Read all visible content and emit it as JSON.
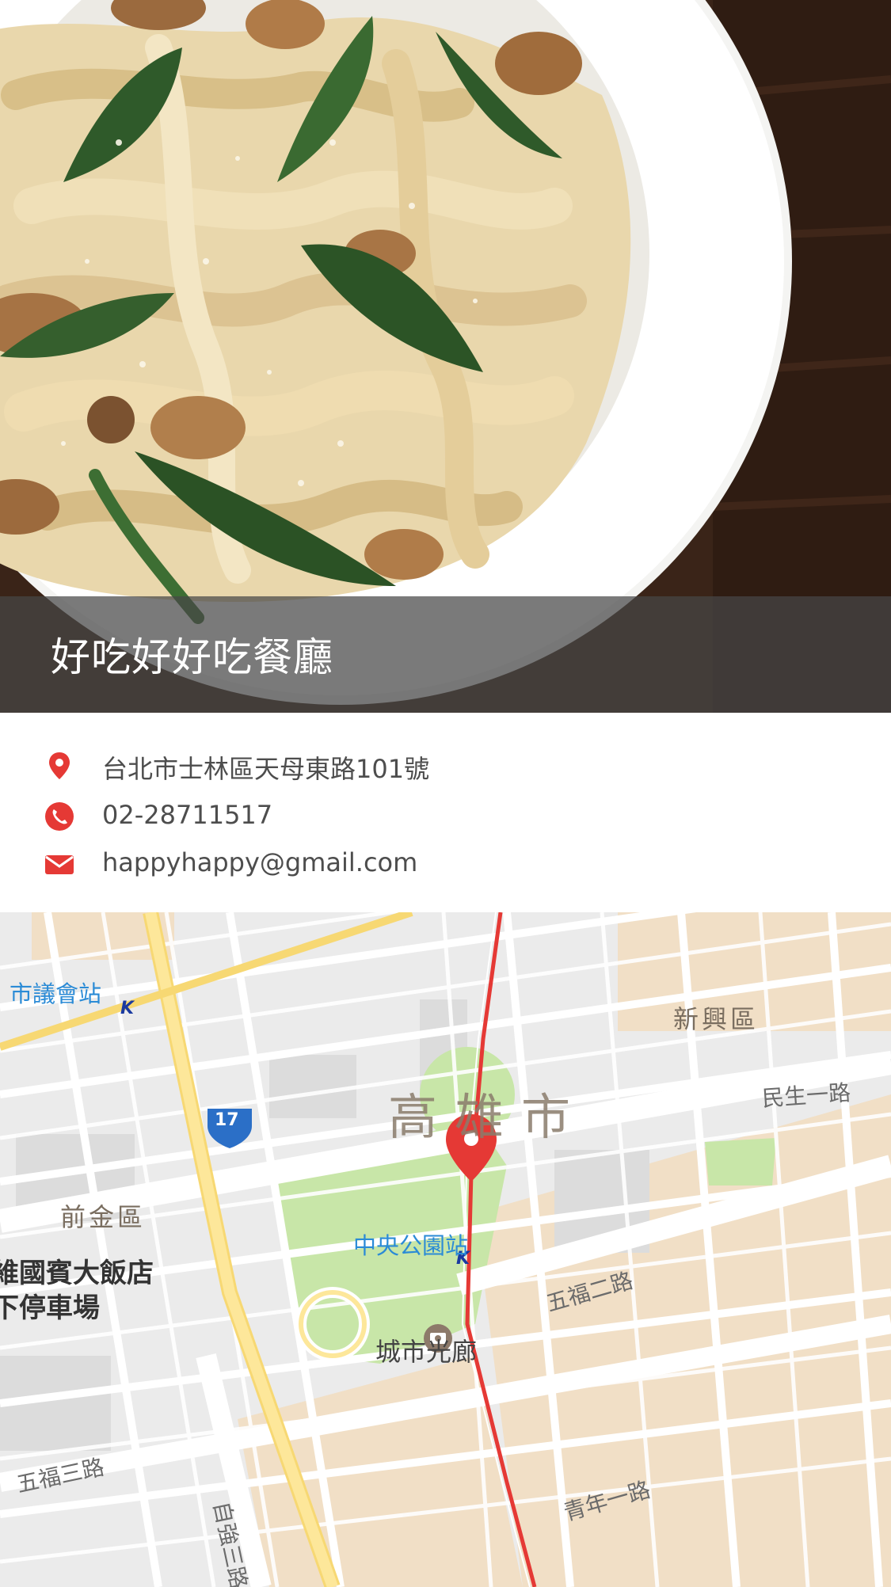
{
  "restaurant": {
    "name": "好吃好好吃餐廳"
  },
  "contact": {
    "address": "台北市士林區天母東路101號",
    "phone": "02-28711517",
    "email": "happyhappy@gmail.com"
  },
  "icons": {
    "address": "map-pin-icon",
    "phone": "phone-icon",
    "email": "envelope-icon",
    "marker": "map-marker-icon",
    "metro": "metro-k-icon",
    "camera": "camera-poi-icon"
  },
  "colors": {
    "accent": "#e53935",
    "text": "#4d4d4d",
    "station": "#2b8bd6",
    "park": "#c8e6a8",
    "road": "#ffffff",
    "highway": "#fde79a"
  },
  "map": {
    "city": "高雄市",
    "districts": {
      "xinxing": "新興區",
      "qianjin": "前金區"
    },
    "stations": {
      "council": "市議會站",
      "central_park": "中央公園站"
    },
    "roads": {
      "minsheng": "民生一路",
      "wufu2": "五福二路",
      "wufu3": "五福三路",
      "qingnian": "青年一路",
      "ziqiang": "自強三路",
      "route": "17"
    },
    "pois": {
      "hotel_line1": "維國賓大飯店",
      "hotel_line2": "下停車場",
      "city_gallery": "城市光廊"
    }
  }
}
